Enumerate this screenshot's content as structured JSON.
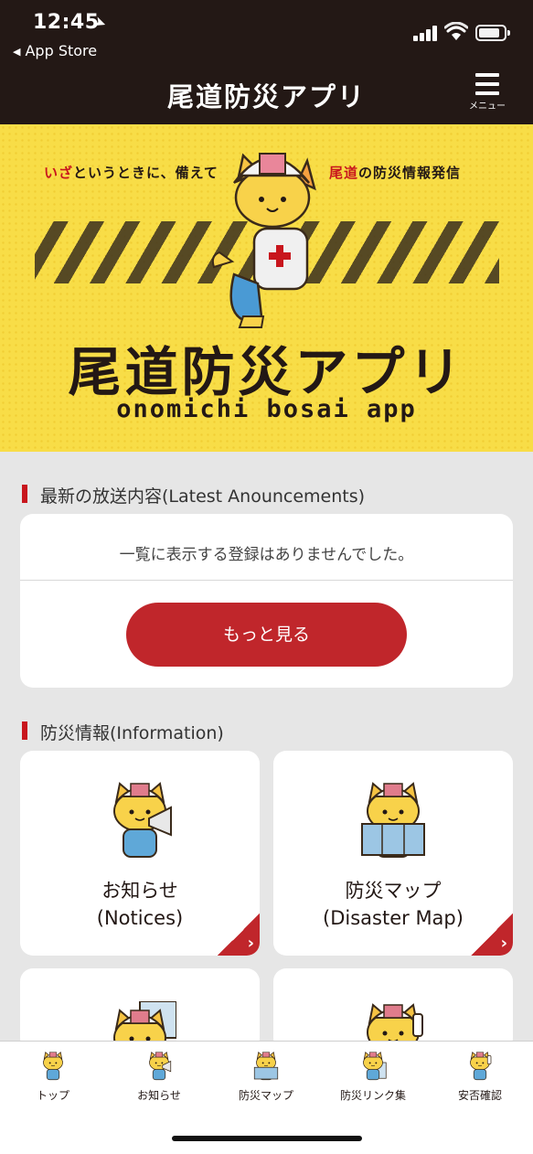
{
  "status_bar": {
    "time": "12:45",
    "back_label": "App Store"
  },
  "header": {
    "title": "尾道防災アプリ",
    "menu_label": "メニュー"
  },
  "hero": {
    "tagline_left_red": "いざ",
    "tagline_left_rest": "というときに、備えて",
    "tagline_right_red": "尾道",
    "tagline_right_rest": "の防災情報発信",
    "logo_text": "尾道防災アプリ",
    "subtitle": "onomichi bosai app"
  },
  "announcements": {
    "heading": "最新の放送内容(Latest Anouncements)",
    "empty_message": "一覧に表示する登録はありませんでした。",
    "more_button": "もっと見る"
  },
  "information": {
    "heading": "防災情報(Information)",
    "tiles": [
      {
        "line1": "お知らせ",
        "line2": "(Notices)",
        "icon": "megaphone-cat-icon"
      },
      {
        "line1": "防災マップ",
        "line2": "(Disaster Map)",
        "icon": "map-cat-icon"
      },
      {
        "line1": "",
        "line2": "",
        "icon": "thermometer-cat-icon"
      },
      {
        "line1": "",
        "line2": "",
        "icon": "phone-cat-icon"
      }
    ]
  },
  "tabbar": {
    "items": [
      {
        "label": "トップ",
        "icon": "home-cat-icon"
      },
      {
        "label": "お知らせ",
        "icon": "megaphone-cat-icon"
      },
      {
        "label": "防災マップ",
        "icon": "map-cat-icon"
      },
      {
        "label": "防災リンク集",
        "icon": "link-cat-icon"
      },
      {
        "label": "安否確認",
        "icon": "safety-cat-icon"
      }
    ]
  },
  "colors": {
    "header_bg": "#231815",
    "hero_bg": "#f8dd47",
    "accent_red": "#c0262b",
    "page_bg": "#e6e6e6"
  }
}
